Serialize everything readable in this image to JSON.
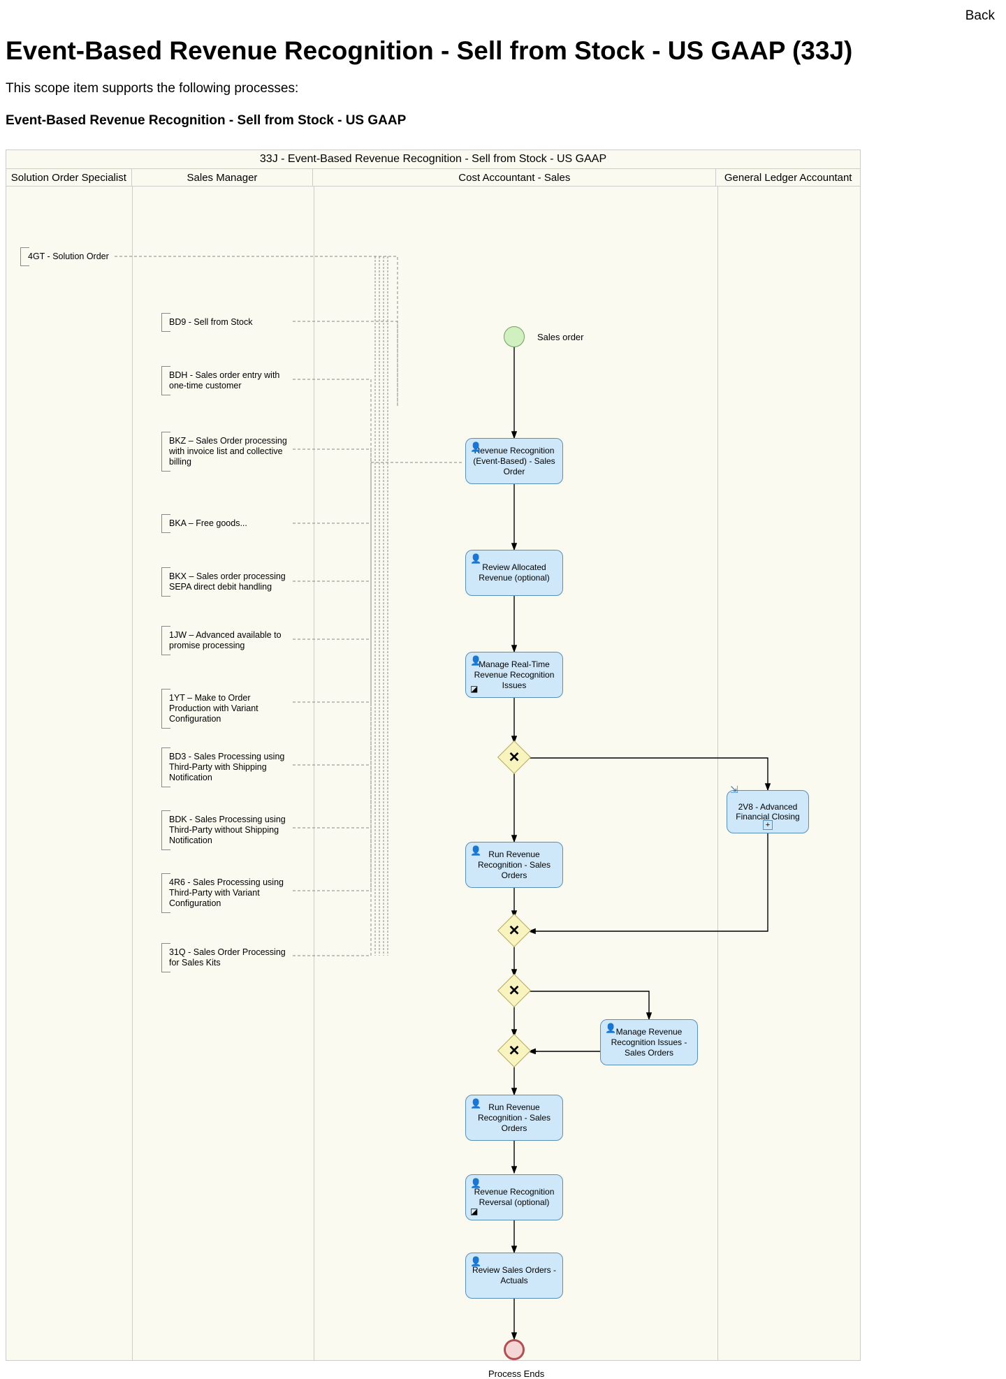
{
  "nav": {
    "back": "Back"
  },
  "page": {
    "title": "Event-Based Revenue Recognition - Sell from Stock - US GAAP (33J)",
    "intro": "This scope item supports the following processes:",
    "subheading": "Event-Based Revenue Recognition - Sell from Stock - US GAAP"
  },
  "diagram": {
    "title": "33J - Event-Based Revenue Recognition - Sell from Stock - US GAAP",
    "lanes": [
      "Solution Order Specialist",
      "Sales Manager",
      "Cost Accountant - Sales",
      "General Ledger Accountant"
    ],
    "start_event_label": "Sales order",
    "end_event_label": "Process Ends",
    "external_refs": [
      "4GT - Solution Order",
      "BD9 - Sell from Stock",
      "BDH - Sales order entry with one-time customer",
      "BKZ – Sales Order processing with invoice list and collective billing",
      "BKA – Free goods...",
      "BKX – Sales order processing SEPA direct debit handling",
      "1JW – Advanced available to promise processing",
      "1YT – Make to Order Production with Variant Configuration",
      "BD3 - Sales Processing using Third-Party with Shipping Notification",
      "BDK - Sales Processing using Third-Party without Shipping Notification",
      "4R6 - Sales Processing using Third-Party with Variant Configuration",
      "31Q - Sales Order Processing for Sales Kits"
    ],
    "tasks": {
      "t1": "Revenue Recognition (Event-Based) - Sales Order",
      "t2": "Review Allocated Revenue (optional)",
      "t3": "Manage Real-Time Revenue Recognition Issues",
      "t4": "Run Revenue Recognition - Sales Orders",
      "t5": "Manage Revenue Recognition Issues - Sales Orders",
      "t6": "Run Revenue Recognition - Sales Orders",
      "t7": "Revenue Recognition Reversal (optional)",
      "t8": "Review Sales Orders - Actuals"
    },
    "subprocess": {
      "s1": "2V8 - Advanced Financial Closing"
    }
  }
}
